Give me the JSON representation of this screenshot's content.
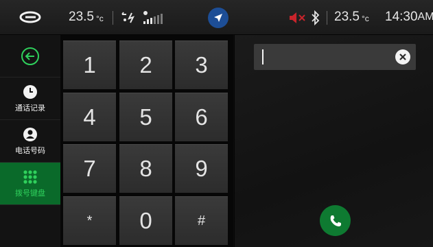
{
  "status_bar": {
    "logo_icon": "brand-logo-icon",
    "outside_temp": "23.5",
    "temp_unit": "°c",
    "fan_icon": "fan-airflow-icon",
    "fan_level_icon": "fan-level-icon",
    "nav_icon": "navigation-arrow-icon",
    "mute_icon": "speaker-muted-icon",
    "bluetooth_icon": "bluetooth-icon",
    "inside_temp": "23.5",
    "inside_temp_unit": "°c",
    "clock": "14:30",
    "clock_suffix": "AM",
    "nav_color": "#1d4e96",
    "mute_color": "#c8242b"
  },
  "sidebar": {
    "back_icon": "back-arrow-icon",
    "items": [
      {
        "label": "通话记录",
        "icon": "clock-icon",
        "active": false
      },
      {
        "label": "电话号码",
        "icon": "contact-person-icon",
        "active": false
      },
      {
        "label": "拨号键盘",
        "icon": "dialpad-grid-icon",
        "active": true
      }
    ],
    "active_color": "#0a6a2a",
    "active_label_color": "#2fd05c"
  },
  "keypad": {
    "keys": [
      "1",
      "2",
      "3",
      "4",
      "5",
      "6",
      "7",
      "8",
      "9",
      "*",
      "0",
      "#"
    ]
  },
  "dial_panel": {
    "input_value": "",
    "clear_icon": "clear-x-icon",
    "call_icon": "phone-call-icon",
    "call_color": "#0e7a31"
  }
}
